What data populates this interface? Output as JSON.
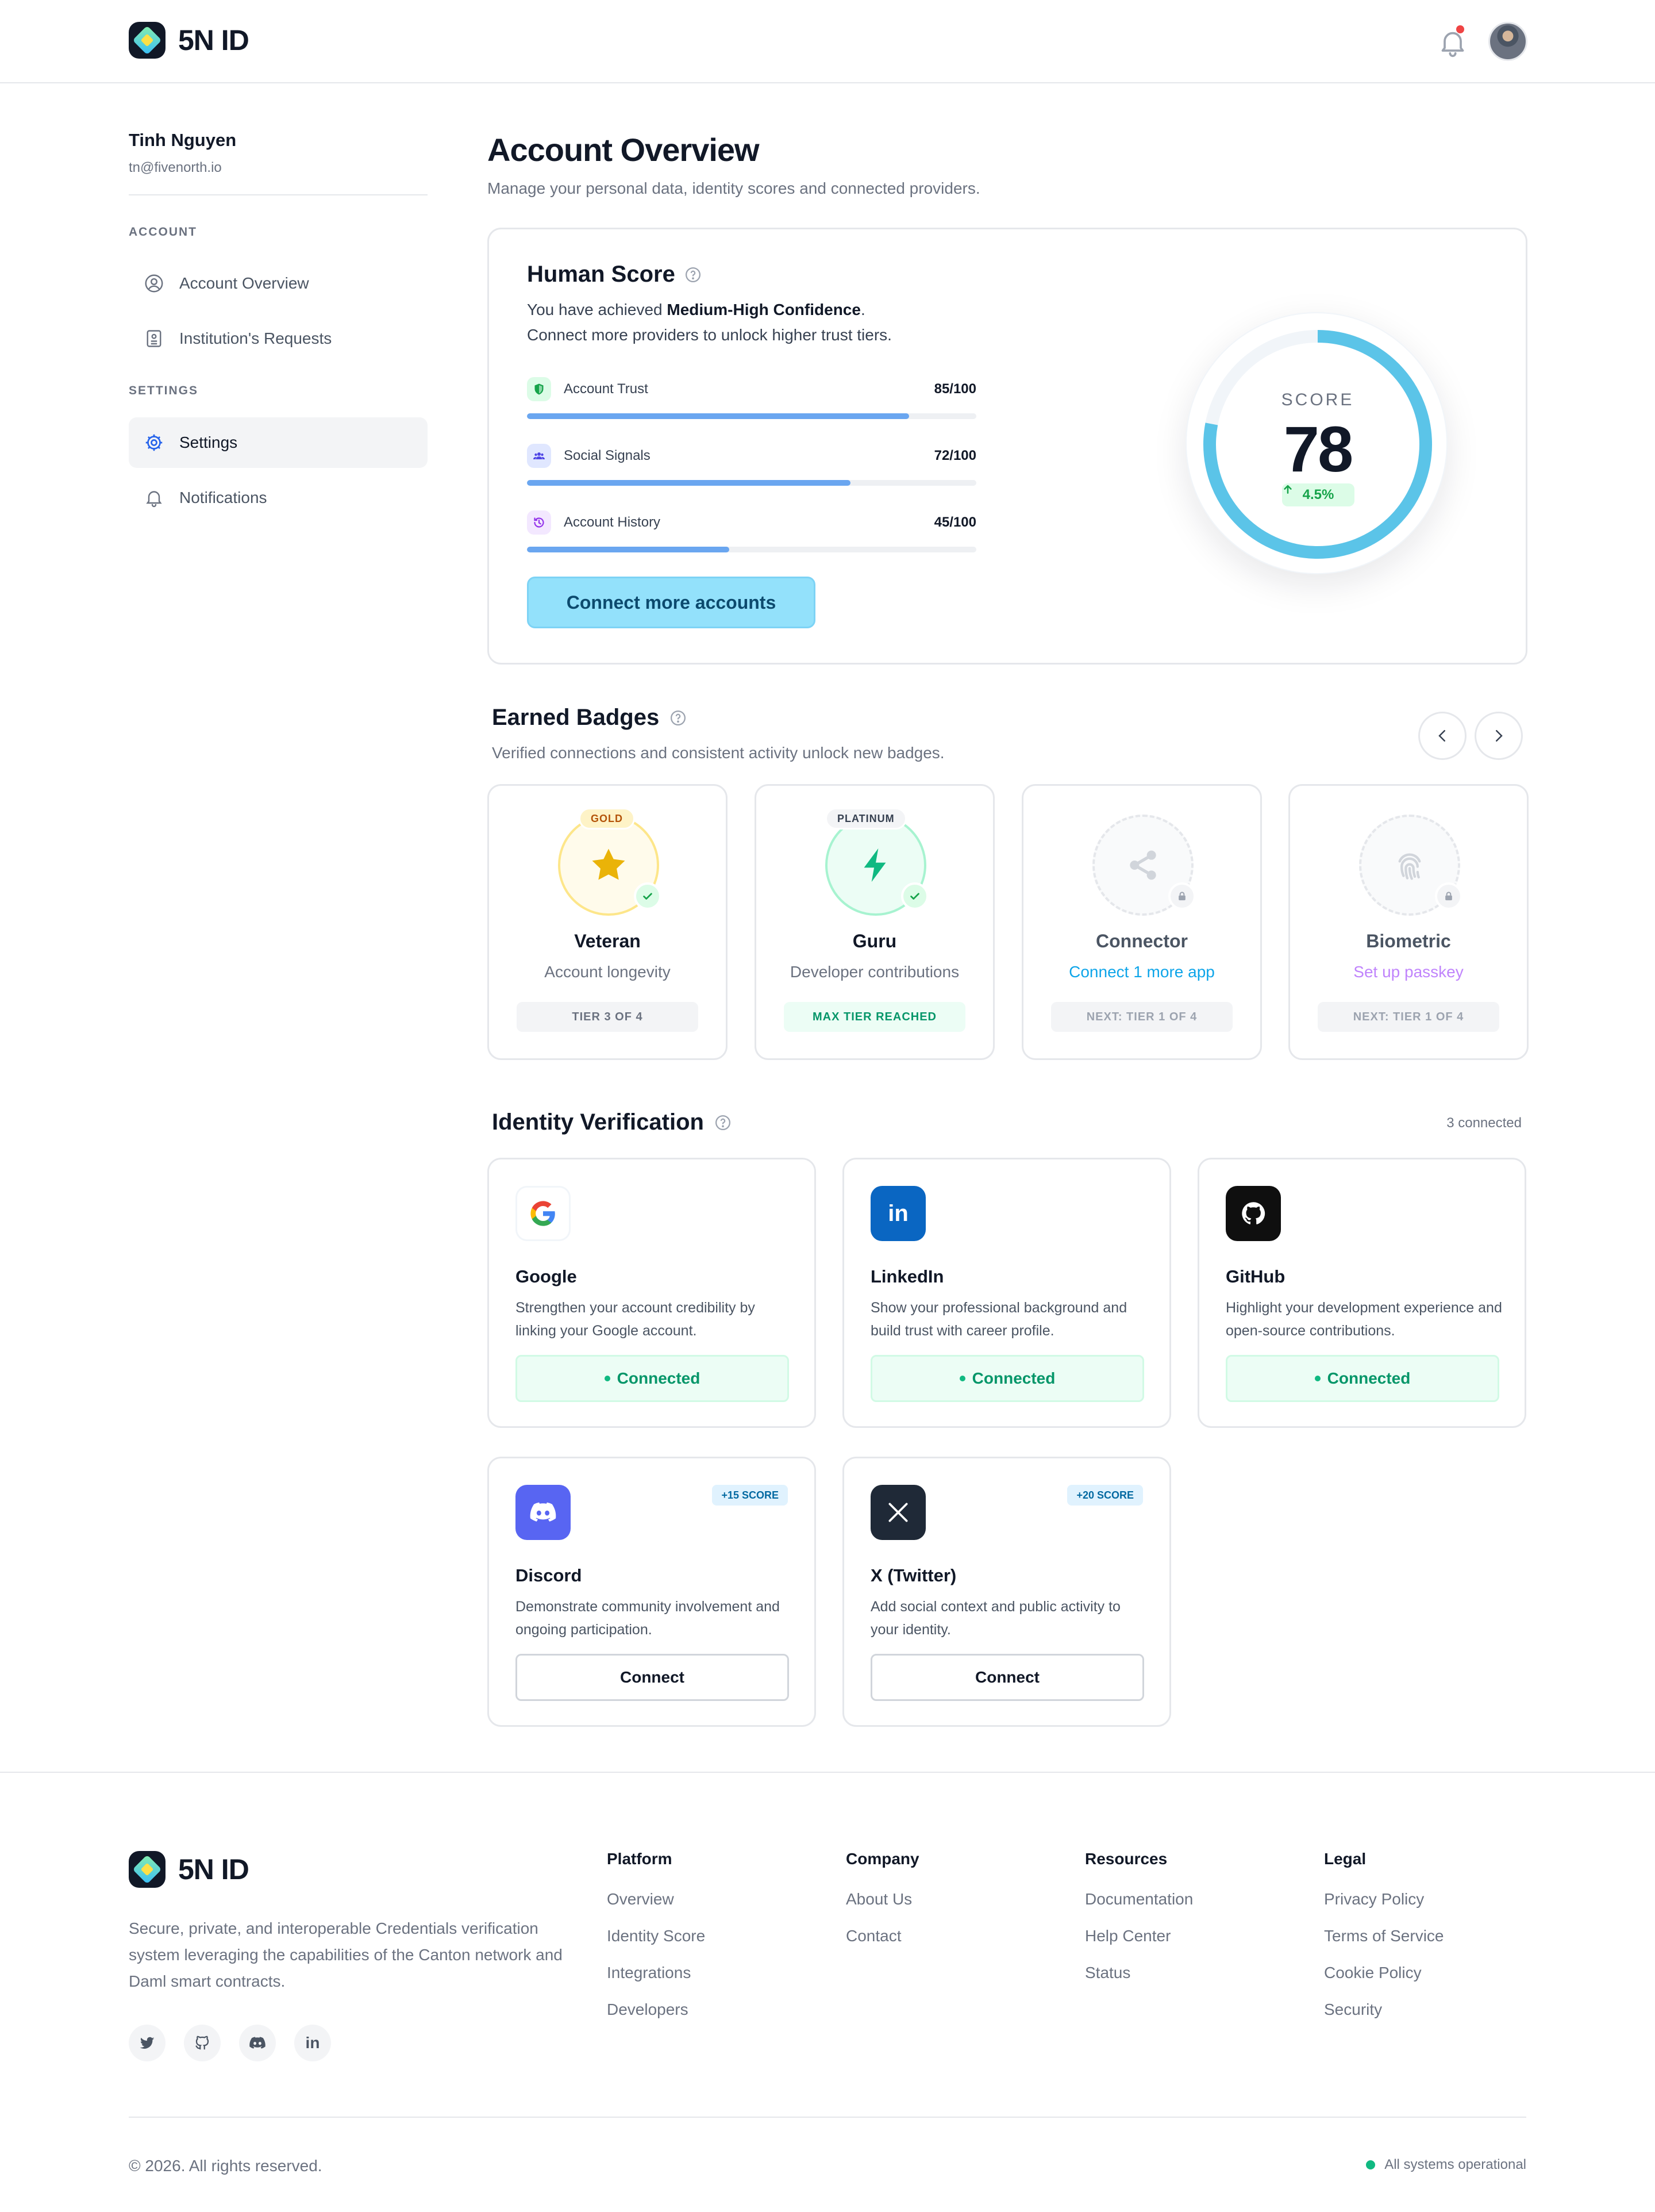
{
  "app": {
    "name": "5N ID"
  },
  "user": {
    "name": "Tinh Nguyen",
    "email": "tn@fivenorth.io"
  },
  "sidebar": {
    "sections": [
      {
        "label": "ACCOUNT"
      },
      {
        "label": "SETTINGS"
      }
    ],
    "items": [
      {
        "label": "Account Overview",
        "icon": "user-circle-icon"
      },
      {
        "label": "Institution's Requests",
        "icon": "document-icon"
      },
      {
        "label": "Settings",
        "icon": "gear-icon",
        "active": true
      },
      {
        "label": "Notifications",
        "icon": "bell-icon"
      }
    ]
  },
  "page": {
    "title": "Account Overview",
    "subtitle": "Manage your personal data, identity scores and connected providers."
  },
  "human_score": {
    "title": "Human Score",
    "line1_prefix": "You have achieved ",
    "line1_strong": "Medium-High Confidence",
    "line1_suffix": ".",
    "line2": "Connect more providers to unlock higher trust tiers.",
    "metrics": [
      {
        "label": "Account Trust",
        "value": "85/100",
        "fraction": 0.85,
        "icon": "shield-icon",
        "icon_color": "#16a34a",
        "icon_bg": "#dcfce7"
      },
      {
        "label": "Social Signals",
        "value": "72/100",
        "fraction": 0.72,
        "icon": "users-icon",
        "icon_color": "#4f46e5",
        "icon_bg": "#e0e7ff"
      },
      {
        "label": "Account History",
        "value": "45/100",
        "fraction": 0.45,
        "icon": "history-icon",
        "icon_color": "#9333ea",
        "icon_bg": "#f3e8ff"
      }
    ],
    "cta": "Connect more accounts",
    "score_label": "SCORE",
    "score": "78",
    "score_fraction": 0.78,
    "delta": "4.5%",
    "ring_color": "#5bc4e8"
  },
  "badges": {
    "title": "Earned Badges",
    "subtitle": "Verified connections and consistent activity unlock new badges.",
    "items": [
      {
        "name": "Veteran",
        "desc": "Account longevity",
        "tag": "GOLD",
        "pill": "TIER 3 OF 4",
        "icon": "star-icon",
        "state": "earned"
      },
      {
        "name": "Guru",
        "desc": "Developer contributions",
        "tag": "PLATINUM",
        "pill": "MAX TIER REACHED",
        "icon": "bolt-icon",
        "state": "earned"
      },
      {
        "name": "Connector",
        "desc": "Connect 1 more app",
        "pill": "NEXT: TIER 1 OF 4",
        "icon": "share-icon",
        "state": "locked"
      },
      {
        "name": "Biometric",
        "desc": "Set up passkey",
        "pill": "NEXT: TIER 1 OF 4",
        "icon": "fingerprint-icon",
        "state": "locked"
      }
    ]
  },
  "identity": {
    "title": "Identity Verification",
    "count": "3 connected",
    "providers": [
      {
        "name": "Google",
        "desc": "Strengthen your account credibility by linking your Google account.",
        "status": "Connected",
        "icon": "google-icon"
      },
      {
        "name": "LinkedIn",
        "desc": "Show your professional background and build trust with career profile.",
        "status": "Connected",
        "icon": "linkedin-icon"
      },
      {
        "name": "GitHub",
        "desc": "Highlight your development experience and open-source contributions.",
        "status": "Connected",
        "icon": "github-icon"
      },
      {
        "name": "Discord",
        "desc": "Demonstrate community involvement and ongoing participation.",
        "action": "Connect",
        "score": "+15 SCORE",
        "icon": "discord-icon"
      },
      {
        "name": "X (Twitter)",
        "desc": "Add social context and public activity to your identity.",
        "action": "Connect",
        "score": "+20 SCORE",
        "icon": "x-icon"
      }
    ]
  },
  "footer": {
    "description": "Secure, private, and interoperable Credentials verification system leveraging the capabilities of the Canton network and Daml smart contracts.",
    "columns": [
      {
        "title": "Platform",
        "links": [
          "Overview",
          "Identity Score",
          "Integrations",
          "Developers"
        ]
      },
      {
        "title": "Company",
        "links": [
          "About Us",
          "Contact"
        ]
      },
      {
        "title": "Resources",
        "links": [
          "Documentation",
          "Help Center",
          "Status"
        ]
      },
      {
        "title": "Legal",
        "links": [
          "Privacy Policy",
          "Terms of Service",
          "Cookie Policy",
          "Security"
        ]
      }
    ],
    "social": [
      "twitter-icon",
      "github-icon",
      "discord-icon",
      "linkedin-icon"
    ],
    "copyright": "© 2026. All rights reserved.",
    "status": "All systems operational"
  },
  "colors": {
    "accent": "#5bc4e8",
    "success": "#10b981",
    "bar": "#6aa6f0"
  }
}
